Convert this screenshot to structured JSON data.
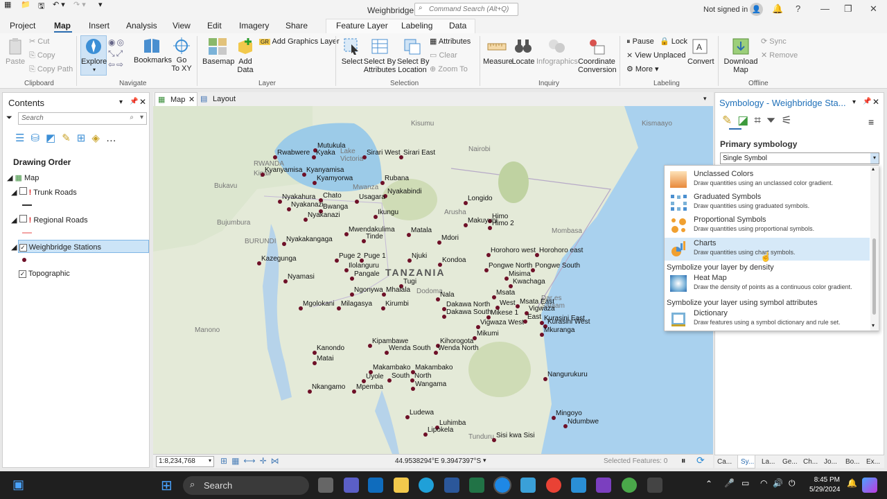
{
  "app": {
    "title": "Weighbridge",
    "command_search": "Command Search (Alt+Q)",
    "signin": "Not signed in"
  },
  "menu": {
    "tabs": [
      "Project",
      "Map",
      "Insert",
      "Analysis",
      "View",
      "Edit",
      "Imagery",
      "Share",
      "Feature Layer",
      "Labeling",
      "Data"
    ]
  },
  "ribbon": {
    "clipboard": {
      "paste": "Paste",
      "cut": "Cut",
      "copy": "Copy",
      "copy_path": "Copy Path",
      "label": "Clipboard"
    },
    "navigate": {
      "explore": "Explore",
      "bookmarks": "Bookmarks",
      "goto": "Go\nTo XY",
      "label": "Navigate"
    },
    "layer": {
      "basemap": "Basemap",
      "add_data": "Add\nData",
      "add_graphics": "Add Graphics Layer",
      "label": "Layer"
    },
    "selection": {
      "select": "Select",
      "by_attr": "Select By\nAttributes",
      "by_loc": "Select By\nLocation",
      "attributes": "Attributes",
      "clear": "Clear",
      "zoom_to": "Zoom To",
      "label": "Selection"
    },
    "inquiry": {
      "measure": "Measure",
      "locate": "Locate",
      "infographics": "Infographics",
      "coord": "Coordinate\nConversion",
      "label": "Inquiry"
    },
    "labeling": {
      "pause": "Pause",
      "lock": "Lock",
      "view_unplaced": "View Unplaced",
      "more": "More",
      "convert": "Convert",
      "label": "Labeling"
    },
    "offline": {
      "download": "Download\nMap",
      "sync": "Sync",
      "remove": "Remove",
      "label": "Offline"
    }
  },
  "contents": {
    "title": "Contents",
    "search_placeholder": "Search",
    "drawing_order": "Drawing Order",
    "layers": {
      "map": "Map",
      "trunk": "Trunk Roads",
      "regional": "Regional Roads",
      "weighbridge": "Weighbridge Stations",
      "topo": "Topographic"
    }
  },
  "doc_tabs": {
    "map": "Map",
    "layout": "Layout"
  },
  "map": {
    "scale": "1:8,234,768",
    "coords": "44.9538294°E 9.3947397°S",
    "selected": "Selected Features: 0",
    "places": [
      {
        "t": "TANZANIA",
        "big": true
      },
      {
        "t": "Kisumu"
      },
      {
        "t": "Nairobi"
      },
      {
        "t": "Kismaayo"
      },
      {
        "t": "RWANDA"
      },
      {
        "t": "Kigali"
      },
      {
        "t": "Lake\nVictoria"
      },
      {
        "t": "Mwanza"
      },
      {
        "t": "Arusha"
      },
      {
        "t": "Mombasa"
      },
      {
        "t": "Bujumbura"
      },
      {
        "t": "BURUNDI"
      },
      {
        "t": "Bukavu"
      },
      {
        "t": "Dodoma"
      },
      {
        "t": "Manono"
      },
      {
        "t": "Tunduru"
      },
      {
        "t": "Dar es\nSalaam"
      }
    ],
    "stations": [
      "Mutukula",
      "Rwabwere",
      "Kyaka",
      "Sirari West",
      "Sirari East",
      "Kyanyamisa",
      "Kyanyamisa",
      "Kyamyorwa",
      "Rubana",
      "Nyakabindi",
      "Nyakahura",
      "Chato",
      "Usagara",
      "Longido",
      "Nyakanazi",
      "Bwanga",
      "Nyakanazi",
      "Ikungu",
      "Himo",
      "Himo 2",
      "Makuyuni",
      "Mwendakulima",
      "Tinde",
      "Matala",
      "Nyakakangaga",
      "Mdori",
      "Horohoro west",
      "Horohoro east",
      "Puge 2",
      "Puge 1",
      "Njuki",
      "Kazegunga",
      "Ilolanguru",
      "Kondoa",
      "Pongwe North",
      "Pongwe South",
      "Pangale",
      "Misima",
      "Nyamasi",
      "Kwachaga",
      "Tugi",
      "Ngonywa",
      "Mhalala",
      "Msata",
      "Msata East",
      "Nala",
      "West",
      "Vigwaza",
      "Mgolokani",
      "Milagasya",
      "Kirumbi",
      "Dakawa North",
      "Mikese 1",
      "East",
      "Kurasini East",
      "Dakawa South",
      "Kurasini West",
      "Vigwaza West",
      "Mkuranga",
      "Mikumi",
      "Kipambawe",
      "Kihorogota",
      "Wenda South",
      "Wenda North",
      "Kanondo",
      "Matai",
      "Makambako",
      "Makambako",
      "South",
      "North",
      "Nangurukuru",
      "Uyole",
      "Wangama",
      "Nkangamo",
      "Mpemba",
      "Mingoyo",
      "Ludewa",
      "Ndumbwe",
      "Luhimba",
      "Lipokela",
      "Sisi kwa Sisi"
    ]
  },
  "symbology": {
    "title": "Symbology - Weighbridge Sta...",
    "primary": "Primary symbology",
    "selected": "Single Symbol",
    "options": [
      {
        "title": "Unclassed Colors",
        "desc": "Draw quantities using an unclassed color gradient."
      },
      {
        "title": "Graduated Symbols",
        "desc": "Draw quantities using graduated symbols."
      },
      {
        "title": "Proportional Symbols",
        "desc": "Draw quantities using proportional symbols."
      },
      {
        "title": "Charts",
        "desc": "Draw quantities using chart symbols."
      },
      {
        "header": "Symbolize your layer by density"
      },
      {
        "title": "Heat Map",
        "desc": "Draw the density of points as a continuous color gradient."
      },
      {
        "header": "Symbolize your layer using symbol attributes"
      },
      {
        "title": "Dictionary",
        "desc": "Draw features using a symbol dictionary and rule set."
      }
    ],
    "bottom_tabs": [
      "Ca...",
      "Sy...",
      "La...",
      "Ge...",
      "Ch...",
      "Jo...",
      "Bo...",
      "Ex..."
    ]
  },
  "taskbar": {
    "search": "Search",
    "time": "8:45 PM",
    "date": "5/29/2024"
  },
  "colors": {
    "accent": "#2b6cb0",
    "station": "#6e1028",
    "water": "#a9d1ee",
    "lake": "#9ccbe8"
  }
}
